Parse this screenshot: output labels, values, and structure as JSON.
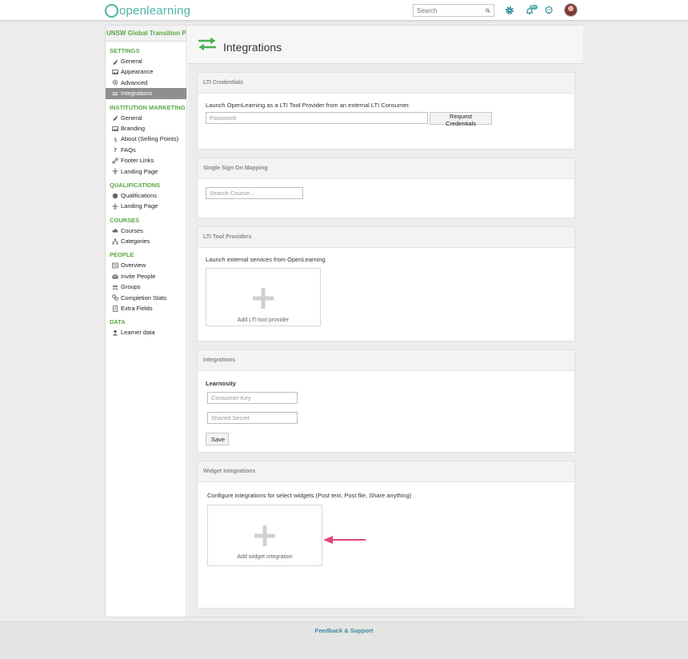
{
  "header": {
    "logo_text": "openlearning",
    "search_placeholder": "Search",
    "notification_badge": "9+",
    "brand_color": "#4fb3a9"
  },
  "sidebar": {
    "program_title": "UNSW Global Transition Program",
    "sections": [
      {
        "heading": "SETTINGS",
        "items": [
          {
            "label": "General",
            "icon": "rocket-icon"
          },
          {
            "label": "Appearance",
            "icon": "image-icon"
          },
          {
            "label": "Advanced",
            "icon": "gear-icon"
          },
          {
            "label": "Integrations",
            "icon": "swap-icon",
            "active": true
          }
        ]
      },
      {
        "heading": "INSTITUTION MARKETING",
        "items": [
          {
            "label": "General",
            "icon": "rocket-icon"
          },
          {
            "label": "Branding",
            "icon": "image-icon"
          },
          {
            "label": "About (Selling Points)",
            "icon": "dollar-icon"
          },
          {
            "label": "FAQs",
            "icon": "question-icon"
          },
          {
            "label": "Footer Links",
            "icon": "link-icon"
          },
          {
            "label": "Landing Page",
            "icon": "plane-icon"
          }
        ]
      },
      {
        "heading": "QUALIFICATIONS",
        "items": [
          {
            "label": "Qualifications",
            "icon": "badge-icon"
          },
          {
            "label": "Landing Page",
            "icon": "plane-icon"
          }
        ]
      },
      {
        "heading": "COURSES",
        "items": [
          {
            "label": "Courses",
            "icon": "cloud-icon"
          },
          {
            "label": "Categories",
            "icon": "sitemap-icon"
          }
        ]
      },
      {
        "heading": "PEOPLE",
        "items": [
          {
            "label": "Overview",
            "icon": "list-icon"
          },
          {
            "label": "Invite People",
            "icon": "envelope-icon"
          },
          {
            "label": "Groups",
            "icon": "group-icon"
          },
          {
            "label": "Completion Stats",
            "icon": "gears-icon"
          },
          {
            "label": "Extra Fields",
            "icon": "doc-icon"
          }
        ]
      },
      {
        "heading": "DATA",
        "items": [
          {
            "label": "Learner data",
            "icon": "user-icon"
          }
        ]
      }
    ]
  },
  "page": {
    "title": "Integrations"
  },
  "lti_credentials": {
    "heading": "LTI Credentials",
    "description": "Launch OpenLearning as a LTI Tool Provider from an external LTI Consumer.",
    "password_placeholder": "Password",
    "request_button": "Request Credentials"
  },
  "sso": {
    "heading": "Single Sign On Mapping",
    "search_placeholder": "Search Course..."
  },
  "lti_providers": {
    "heading": "LTI Tool Providers",
    "description": "Launch external services from OpenLearning",
    "add_label": "Add LTI tool provider"
  },
  "integrations": {
    "heading": "Integrations",
    "learnosity_label": "Learnosity",
    "consumer_key_placeholder": "Consumer Key",
    "shared_secret_placeholder": "Shared Secret",
    "save_button": "Save"
  },
  "widget_integrations": {
    "heading": "Widget integrations",
    "description": "Configure integrations for select widgets (Post text, Post file, Share anything)",
    "add_label": "Add widget integration"
  },
  "annotation_arrow_color": "#e0457b",
  "footer": {
    "link_text": "Feedback & Support"
  }
}
